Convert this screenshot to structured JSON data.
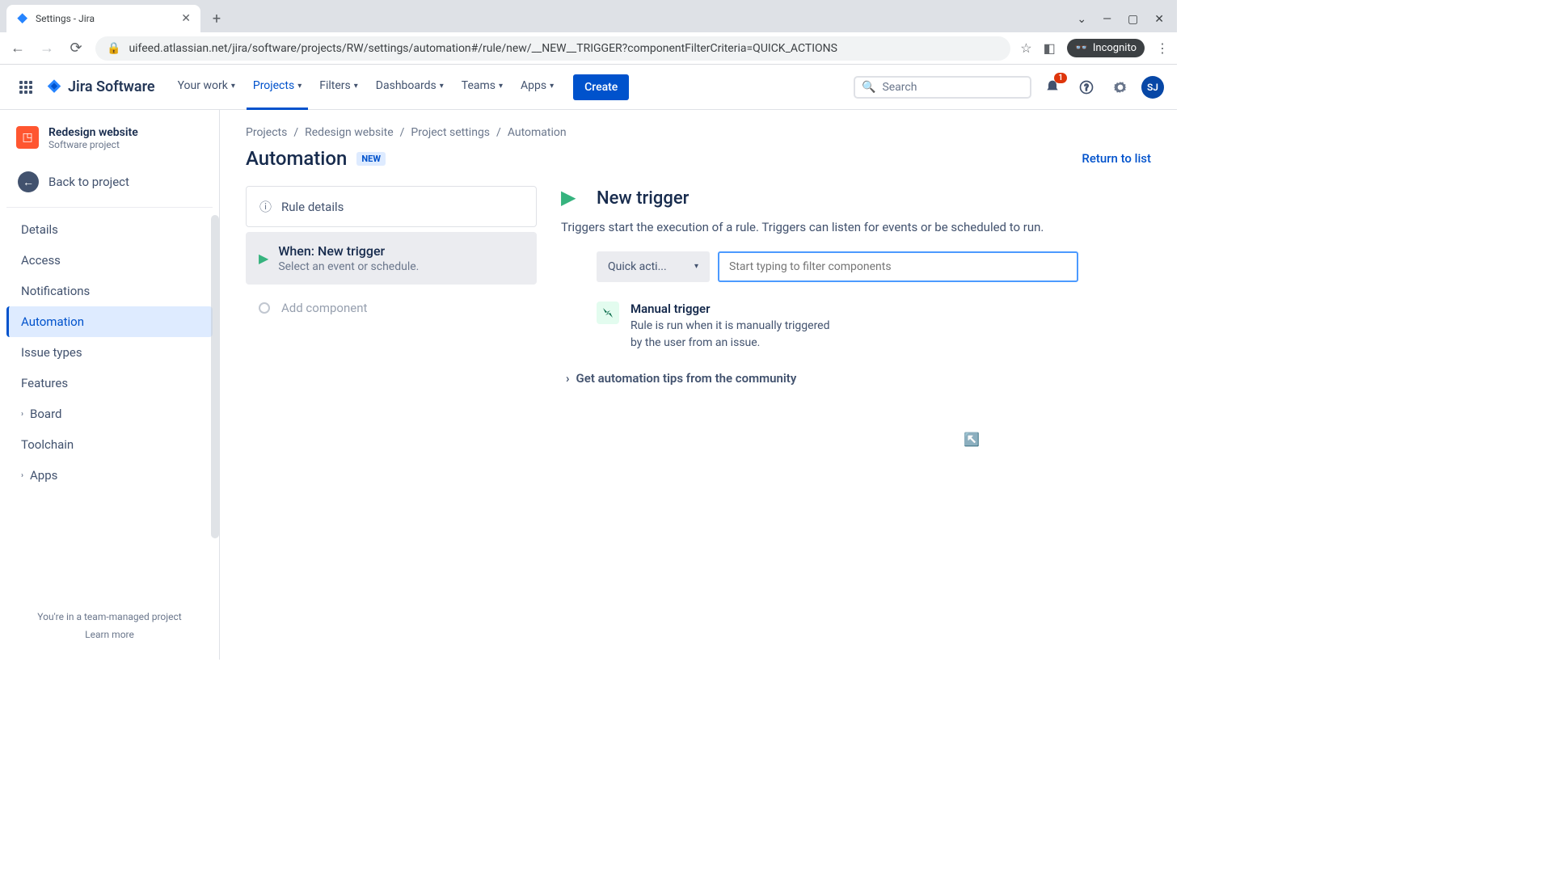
{
  "browser": {
    "tab_title": "Settings - Jira",
    "url": "uifeed.atlassian.net/jira/software/projects/RW/settings/automation#/rule/new/__NEW__TRIGGER?componentFilterCriteria=QUICK_ACTIONS",
    "incognito_label": "Incognito"
  },
  "header": {
    "product": "Jira Software",
    "nav": {
      "your_work": "Your work",
      "projects": "Projects",
      "filters": "Filters",
      "dashboards": "Dashboards",
      "teams": "Teams",
      "apps": "Apps"
    },
    "create": "Create",
    "search_placeholder": "Search",
    "notification_count": "1",
    "avatar_initials": "SJ"
  },
  "sidebar": {
    "project_name": "Redesign website",
    "project_type": "Software project",
    "back": "Back to project",
    "items": {
      "details": "Details",
      "access": "Access",
      "notifications": "Notifications",
      "automation": "Automation",
      "issue_types": "Issue types",
      "features": "Features",
      "board": "Board",
      "toolchain": "Toolchain",
      "apps": "Apps"
    },
    "footer_text": "You're in a team-managed project",
    "footer_link": "Learn more"
  },
  "breadcrumbs": {
    "projects": "Projects",
    "project": "Redesign website",
    "settings": "Project settings",
    "automation": "Automation"
  },
  "page": {
    "title": "Automation",
    "new_badge": "NEW",
    "return": "Return to list"
  },
  "rule": {
    "details_label": "Rule details",
    "when_title": "When: New trigger",
    "when_sub": "Select an event or schedule.",
    "add_component": "Add component"
  },
  "config": {
    "title": "New trigger",
    "description": "Triggers start the execution of a rule. Triggers can listen for events or be scheduled to run.",
    "quick_actions_label": "Quick acti...",
    "filter_placeholder": "Start typing to filter components",
    "trigger_option": {
      "title": "Manual trigger",
      "desc": "Rule is run when it is manually triggered by the user from an issue."
    },
    "tips": "Get automation tips from the community"
  }
}
